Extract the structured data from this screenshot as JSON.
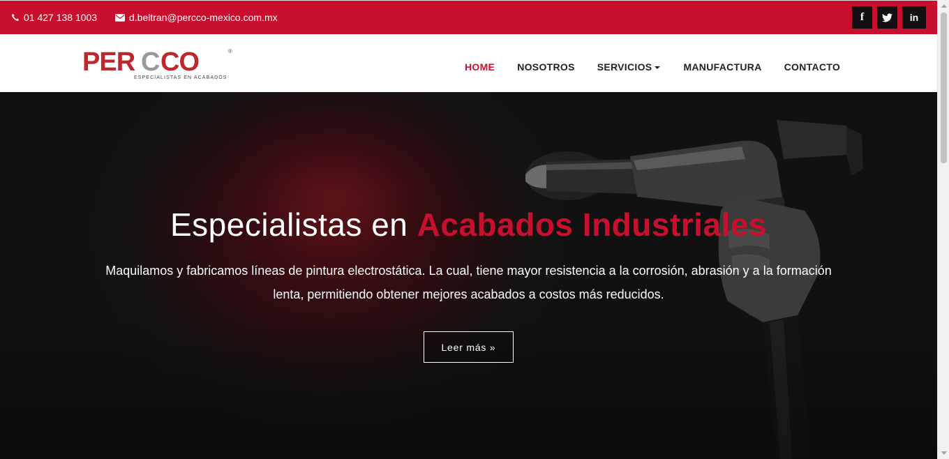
{
  "topbar": {
    "phone": "01 427 138 1003",
    "email": "d.beltran@percco-mexico.com.mx",
    "social": [
      {
        "label": "f",
        "icon": "facebook-icon"
      },
      {
        "label": "t",
        "icon": "twitter-icon"
      },
      {
        "label": "in",
        "icon": "linkedin-icon"
      }
    ],
    "color": "#c8102e"
  },
  "logo": {
    "text_left": "PER",
    "text_right": "CCO",
    "tagline": "ESPECIALISTAS EN ACABADOS",
    "registered": "®"
  },
  "nav": {
    "items": [
      {
        "label": "HOME",
        "active": true
      },
      {
        "label": "NOSOTROS",
        "active": false
      },
      {
        "label": "SERVICIOS",
        "active": false,
        "dropdown": true
      },
      {
        "label": "MANUFACTURA",
        "active": false
      },
      {
        "label": "CONTACTO",
        "active": false
      }
    ]
  },
  "hero": {
    "title_plain": "Especialistas en ",
    "title_accent": "Acabados Industriales",
    "description": "Maquilamos y fabricamos líneas de pintura electrostática. La cual, tiene mayor resistencia a la corrosión, abrasión y a la formación lenta, permitiendo obtener mejores acabados a costos más reducidos.",
    "button_label": "Leer más »",
    "accent_color": "#c8102e"
  }
}
